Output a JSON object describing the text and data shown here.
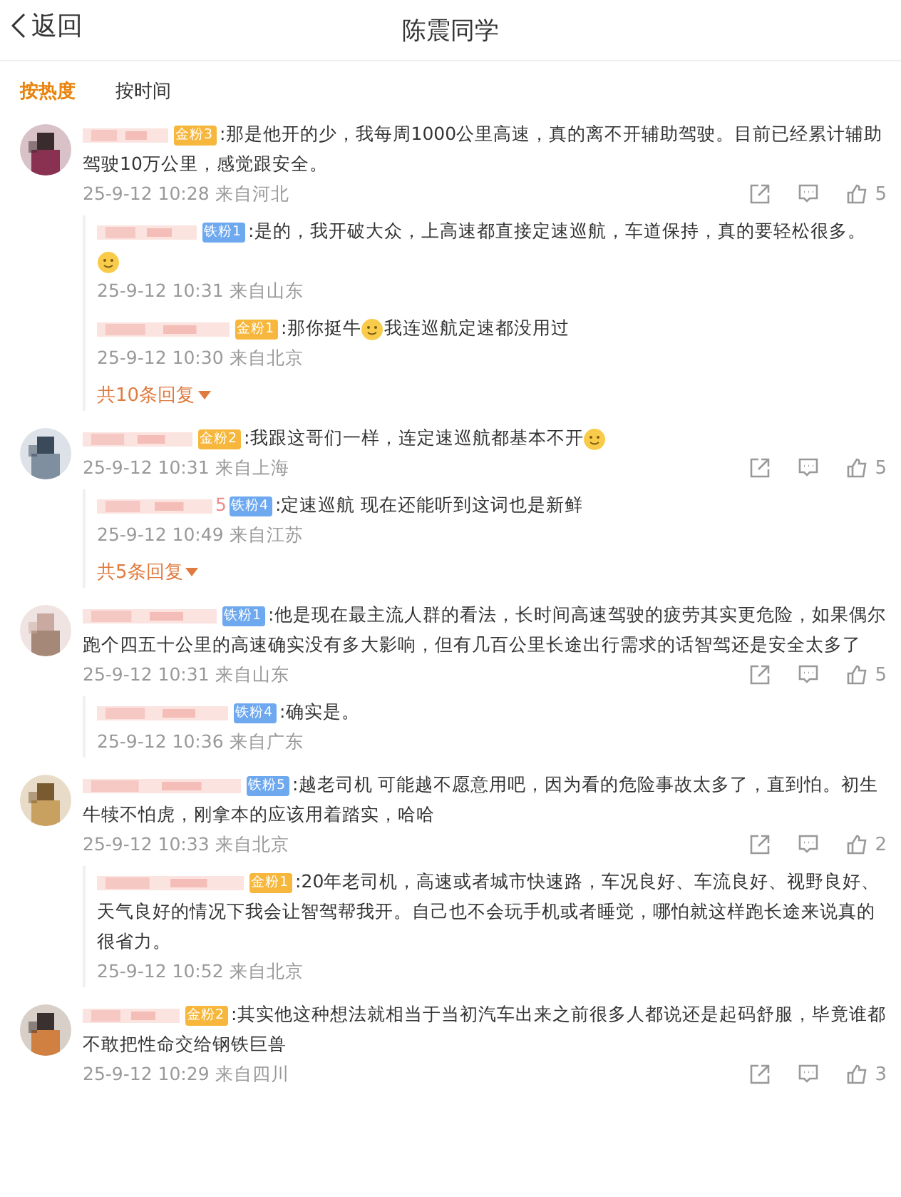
{
  "header": {
    "back": "返回",
    "title": "陈震同学"
  },
  "sort_tabs": [
    {
      "label": "按热度",
      "selected": true
    },
    {
      "label": "按时间",
      "selected": false
    }
  ],
  "comments": [
    {
      "badge": {
        "label": "金粉3",
        "color": "#f6b73c"
      },
      "segments": [
        {
          "kind": "text",
          "text": ":那是他开的少，我每周1000公里高速，真的离不开辅助驾驶。目前已经累计辅助驾驶10万公里，感觉跟安全。"
        }
      ],
      "time": "25-9-12 10:28",
      "place": "来自河北",
      "likes": "5",
      "replies": [
        {
          "badge": {
            "label": "铁粉1",
            "color": "#6ea8ef"
          },
          "segments": [
            {
              "kind": "text",
              "text": ":是的，我开破大众，上高速都直接定速巡航，车道保持，真的要轻松很多。"
            },
            {
              "kind": "emoji"
            }
          ],
          "time": "25-9-12 10:31",
          "place": "来自山东"
        },
        {
          "badge": {
            "label": "金粉1",
            "color": "#f6b73c"
          },
          "segments": [
            {
              "kind": "text",
              "text": ":那你挺牛"
            },
            {
              "kind": "emoji"
            },
            {
              "kind": "text",
              "text": "我连巡航定速都没用过"
            }
          ],
          "time": "25-9-12 10:30",
          "place": "来自北京"
        }
      ],
      "more_replies": "共10条回复"
    },
    {
      "badge": {
        "label": "金粉2",
        "color": "#f6b73c"
      },
      "segments": [
        {
          "kind": "text",
          "text": ":我跟这哥们一样，连定速巡航都基本不开"
        },
        {
          "kind": "emoji"
        }
      ],
      "time": "25-9-12 10:31",
      "place": "来自上海",
      "likes": "5",
      "replies": [
        {
          "name_suffix": "5",
          "badge": {
            "label": "铁粉4",
            "color": "#6ea8ef"
          },
          "segments": [
            {
              "kind": "text",
              "text": ":定速巡航  现在还能听到这词也是新鲜"
            }
          ],
          "time": "25-9-12 10:49",
          "place": "来自江苏"
        }
      ],
      "more_replies": "共5条回复"
    },
    {
      "badge": {
        "label": "铁粉1",
        "color": "#6ea8ef"
      },
      "segments": [
        {
          "kind": "text",
          "text": ":他是现在最主流人群的看法，长时间高速驾驶的疲劳其实更危险，如果偶尔跑个四五十公里的高速确实没有多大影响，但有几百公里长途出行需求的话智驾还是安全太多了"
        }
      ],
      "time": "25-9-12 10:31",
      "place": "来自山东",
      "likes": "5",
      "replies": [
        {
          "badge": {
            "label": "铁粉4",
            "color": "#6ea8ef"
          },
          "segments": [
            {
              "kind": "text",
              "text": ":确实是。"
            }
          ],
          "time": "25-9-12 10:36",
          "place": "来自广东"
        }
      ]
    },
    {
      "badge": {
        "label": "铁粉5",
        "color": "#6ea8ef"
      },
      "segments": [
        {
          "kind": "text",
          "text": ":越老司机 可能越不愿意用吧，因为看的危险事故太多了，直到怕。初生牛犊不怕虎，刚拿本的应该用着踏实，哈哈"
        }
      ],
      "time": "25-9-12 10:33",
      "place": "来自北京",
      "likes": "2",
      "replies": [
        {
          "badge": {
            "label": "金粉1",
            "color": "#f6b73c"
          },
          "segments": [
            {
              "kind": "text",
              "text": ":20年老司机，高速或者城市快速路，车况良好、车流良好、视野良好、天气良好的情况下我会让智驾帮我开。自己也不会玩手机或者睡觉，哪怕就这样跑长途来说真的很省力。"
            }
          ],
          "time": "25-9-12 10:52",
          "place": "来自北京"
        }
      ]
    },
    {
      "badge": {
        "label": "金粉2",
        "color": "#f6b73c"
      },
      "segments": [
        {
          "kind": "text",
          "text": ":其实他这种想法就相当于当初汽车出来之前很多人都说还是起码舒服，毕竟谁都不敢把性命交给钢铁巨兽"
        }
      ],
      "time": "25-9-12 10:29",
      "place": "来自四川",
      "likes": "3"
    }
  ]
}
